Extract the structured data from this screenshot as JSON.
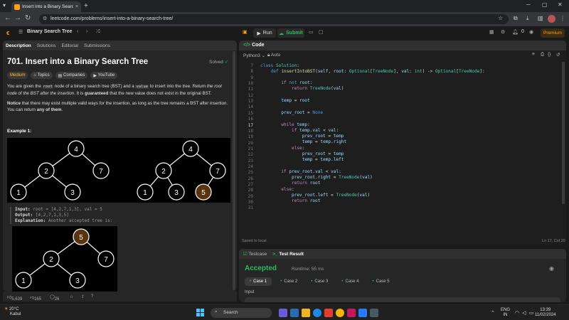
{
  "browser": {
    "tab_title": "Insert into a Binary Search Tree",
    "tab_close": "×",
    "new_tab": "+",
    "url": "leetcode.com/problems/insert-into-a-binary-search-tree/"
  },
  "lc_header": {
    "problem_list": "Binary Search Tree",
    "run_label": "Run",
    "submit_label": "Submit",
    "streak": "0",
    "premium_label": "Premium"
  },
  "left": {
    "tabs": [
      "Description",
      "Solutions",
      "Editorial",
      "Submissions"
    ],
    "title": "701. Insert into a Binary Search Tree",
    "solved": "Solved",
    "difficulty": "Medium",
    "tags": [
      "Topics",
      "Companies",
      "YouTube"
    ],
    "desc1_a": "You are given the ",
    "desc1_code1": "root",
    "desc1_b": " node of a binary search tree (BST) and a ",
    "desc1_code2": "value",
    "desc1_c": " to insert into the tree. Return ",
    "desc1_em": "the root node of the BST after the insertion",
    "desc1_d": ". It is ",
    "desc1_strong": "guaranteed",
    "desc1_e": " that the new value does not exist in the original BST.",
    "desc2_strong": "Notice",
    "desc2_a": " that there may exist multiple valid ways for the insertion, as long as the tree remains a BST after insertion. You can return ",
    "desc2_strong2": "any of them",
    "desc2_b": ".",
    "example_label": "Example 1:",
    "ex_input_label": "Input:",
    "ex_input": "root = [4,2,7,1,3], val = 5",
    "ex_output_label": "Output:",
    "ex_output": "[4,2,7,1,3,5]",
    "ex_expl_label": "Explanation:",
    "ex_expl": "Another accepted tree is:",
    "likes": "5,639",
    "dislikes": "165",
    "comments": "26"
  },
  "trees": {
    "tree1": [
      "4",
      "2",
      "7",
      "1",
      "3"
    ],
    "tree2": [
      "4",
      "2",
      "7",
      "1",
      "3",
      "5"
    ],
    "tree3": [
      "5",
      "2",
      "7",
      "1",
      "3"
    ]
  },
  "code": {
    "header": "Code",
    "language": "Python3",
    "autosave": "Auto",
    "line_numbers": [
      "7",
      "8",
      "9",
      "10",
      "11",
      "12",
      "13",
      "14",
      "15",
      "16",
      "17",
      "18",
      "19",
      "20",
      "21",
      "22",
      "23",
      "24",
      "25",
      "26",
      "27",
      "28",
      "29",
      "30",
      "31"
    ],
    "saved": "Saved to local",
    "cursor": "Ln 17, Col 20"
  },
  "test": {
    "tab1": "Testcase",
    "tab2": "Test Result",
    "status": "Accepted",
    "runtime": "Runtime: 55 ms",
    "cases": [
      "Case 1",
      "Case 2",
      "Case 3",
      "Case 4",
      "Case 5"
    ],
    "input_label": "Input"
  },
  "taskbar": {
    "temp": "20°C",
    "location": "Kabul",
    "search": "Search",
    "lang": "ENG",
    "region": "IN",
    "time": "13:39",
    "date": "11/02/2024"
  }
}
